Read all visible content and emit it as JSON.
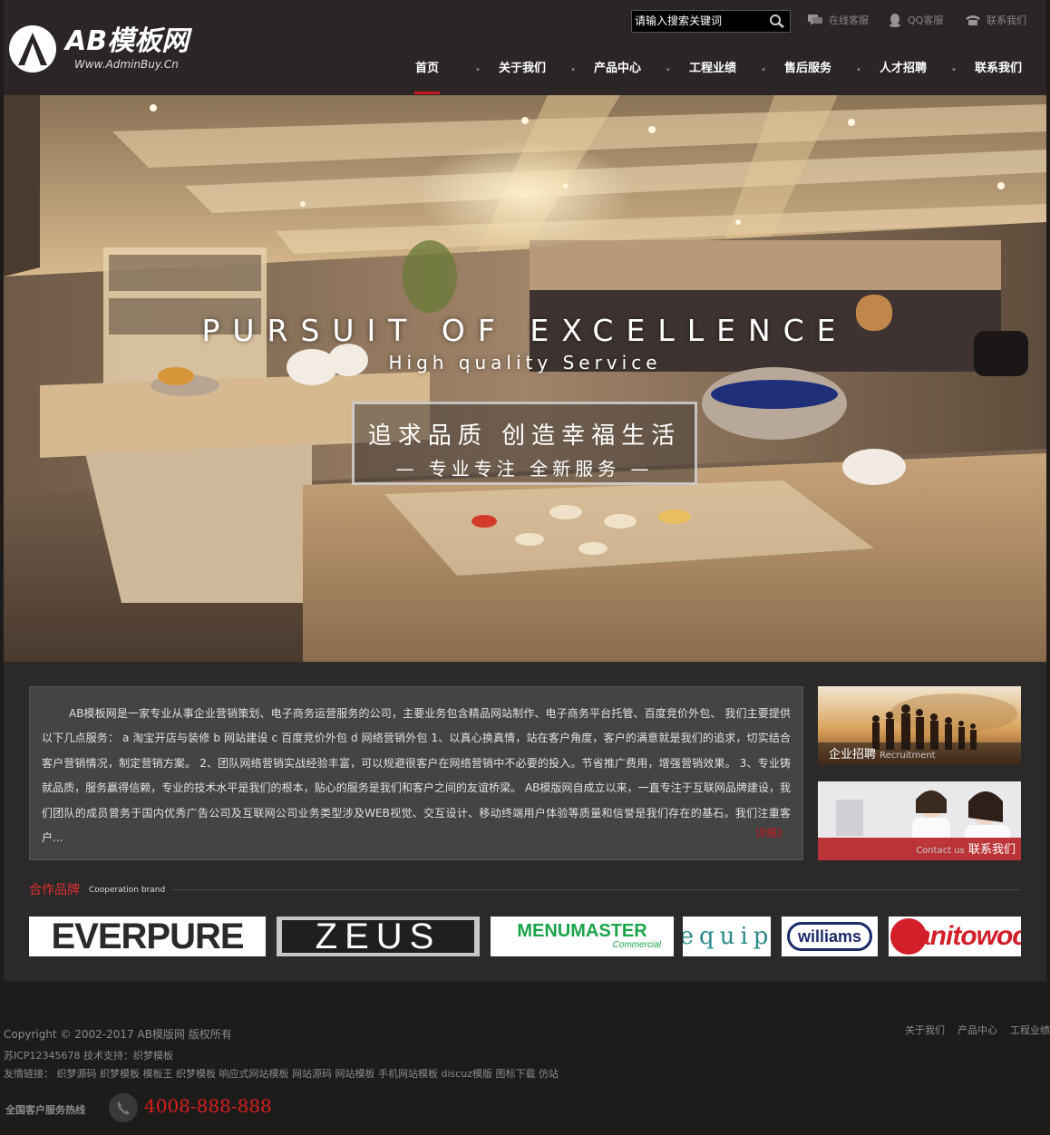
{
  "header": {
    "logo_text": "AB模板网",
    "logo_url_text": "Www.AdminBuy.Cn",
    "search_placeholder": "请输入搜索关键词",
    "top_links": [
      {
        "label": "在线客服",
        "icon": "chat-icon"
      },
      {
        "label": "QQ客服",
        "icon": "qq-penguin-icon"
      },
      {
        "label": "联系我们",
        "icon": "telephone-icon"
      }
    ],
    "nav": [
      "首页",
      "关于我们",
      "产品中心",
      "工程业绩",
      "售后服务",
      "人才招聘",
      "联系我们"
    ],
    "active_nav": "首页"
  },
  "banner": {
    "title": "PURSUIT OF EXCELLENCE",
    "subtitle": "High quality Service",
    "cn_line1": "追求品质 创造幸福生活",
    "cn_line2": "— 专业专注 全新服务 —"
  },
  "about": {
    "text": "AB模板网是一家专业从事企业营销策划、电子商务运营服务的公司，主要业务包含精品网站制作、电子商务平台托管、百度竞价外包、 我们主要提供以下几点服务： a 淘宝开店与装修 b 网站建设 c 百度竞价外包 d 网络营销外包 1、以真心换真情，站在客户角度，客户的满意就是我们的追求，切实结合客户营销情况，制定营销方案。 2、团队网络营销实战经验丰富，可以规避很客户在网络营销中不必要的投入。节省推广费用，增强营销效果。 3、专业铸就品质，服务赢得信赖，专业的技术水平是我们的根本，贴心的服务是我们和客户之间的友谊桥梁。 AB模版网自成立以来，一直专注于互联网品牌建设，我们团队的成员曾务于国内优秀广告公司及互联网公司业务类型涉及WEB视觉、交互设计、移动终端用户体验等质量和信誉是我们存在的基石。我们注重客户...",
    "more": "详细》"
  },
  "side_cards": {
    "recruit_cn": "企业招聘",
    "recruit_en": "Recruitment",
    "contact_en": "Contact us",
    "contact_cn": "联系我们"
  },
  "brands": {
    "title": "合作品牌",
    "subtitle": "Cooperation brand",
    "logos": [
      "EVERPURE",
      "ZEUS",
      "MENUMASTER",
      "Commercial",
      "equip",
      "williams",
      "Manitowoc"
    ]
  },
  "footer": {
    "copyright": "Copyright © 2002-2017 AB模版网 版权所有",
    "icp": "苏ICP12345678  技术支持：织梦模板",
    "friend_links": "友情链接：  织梦源码  织梦模板  模板王  织梦模板  响应式网站模板  网站源码  网站模板  手机网站模板  discuz模版  图标下载  仿站",
    "links": [
      "关于我们",
      "产品中心",
      "工程业绩"
    ],
    "hotline_label": "全国客户服务热线",
    "hotline": "4008-888-888"
  },
  "colors": {
    "accent_red": "#c8161d",
    "header_bg": "#2b2625",
    "content_bg": "#2b2929",
    "page_bg": "#1e1b1b"
  }
}
